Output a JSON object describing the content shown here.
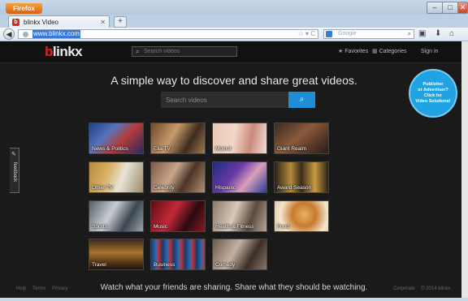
{
  "browser": {
    "app_button": "Firefox",
    "tab_title": "blinkx Video",
    "tab_favicon": "b",
    "new_tab": "+",
    "url": "www.blinkx.com",
    "search_engine_placeholder": "Google",
    "window_controls": [
      "–",
      "□",
      "✕"
    ]
  },
  "header": {
    "logo_first": "b",
    "logo_rest": "linkx",
    "search_placeholder": "Search videos",
    "nav": {
      "favorites": "Favorites",
      "categories": "Categories",
      "signin": "Sign in"
    }
  },
  "hero": {
    "tagline": "A simple way to discover and share great videos.",
    "search_placeholder": "Search videos"
  },
  "promo": {
    "line1": "Publisher",
    "line2": "or Advertiser?",
    "line3": "Click for",
    "line4": "Video Solutions!"
  },
  "feedback": {
    "label": "feedback"
  },
  "categories": [
    {
      "label": "News & Politics"
    },
    {
      "label": "Ella TV"
    },
    {
      "label": "Mom.it"
    },
    {
      "label": "Giant Realm"
    },
    {
      "label": "Other TV"
    },
    {
      "label": "Celebrity"
    },
    {
      "label": "Hispanic"
    },
    {
      "label": "Award Season"
    },
    {
      "label": "Sports"
    },
    {
      "label": "Music"
    },
    {
      "label": "Health & Fitness"
    },
    {
      "label": "Food"
    },
    {
      "label": "Travel"
    },
    {
      "label": "Business"
    },
    {
      "label": "Comedy"
    }
  ],
  "footer": {
    "links": [
      "Help",
      "Terms",
      "Privacy"
    ],
    "tagline": "Watch what your friends are sharing. Share what they should be watching.",
    "corporate": "Corporate",
    "copyright": "© 2014 blinkx"
  },
  "colors": {
    "brand_red": "#e0241a",
    "search_button_blue": "#1e8fd6",
    "promo_blue": "#21a2e2",
    "page_background": "#1a1a1a"
  }
}
